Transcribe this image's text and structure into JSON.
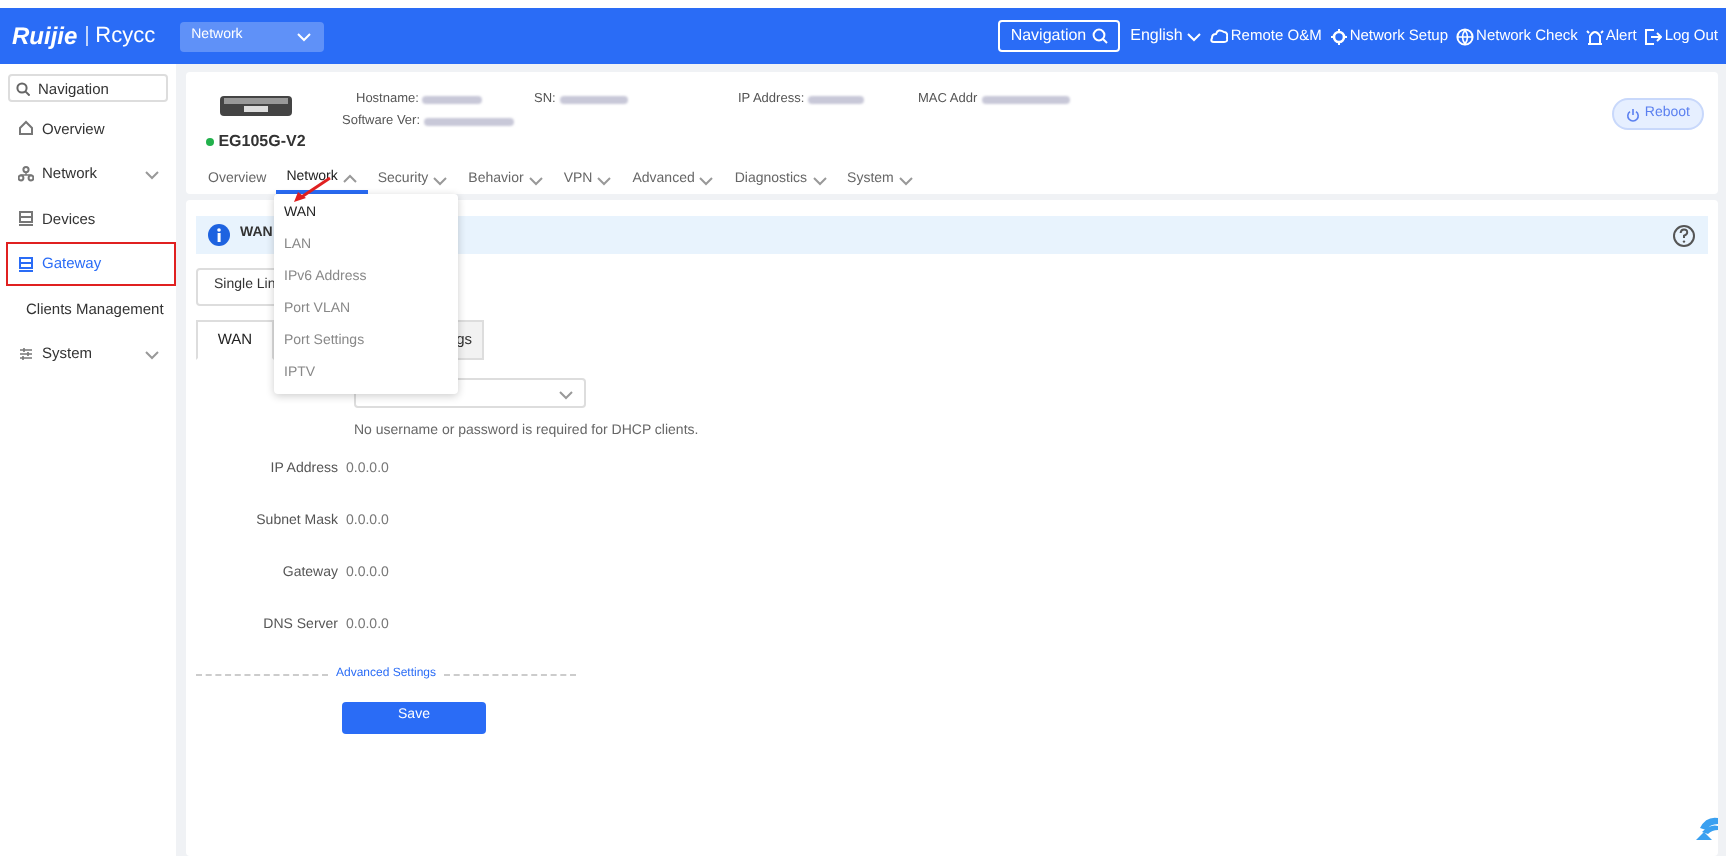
{
  "header": {
    "logo": "Ruijie",
    "brand": "Rcycc",
    "scope_select": "Network",
    "nav_search": "Navigation",
    "language": "English",
    "links": [
      {
        "kind": "cloud",
        "label": "Remote O&M"
      },
      {
        "kind": "setup",
        "label": "Network Setup"
      },
      {
        "kind": "check",
        "label": "Network Check"
      },
      {
        "kind": "alert",
        "label": "Alert"
      },
      {
        "kind": "logout",
        "label": "Log Out"
      }
    ]
  },
  "sidebar": {
    "search_placeholder": "Navigation",
    "items": [
      {
        "kind": "home",
        "label": "Overview",
        "selected": false,
        "expandable": false
      },
      {
        "kind": "network",
        "label": "Network",
        "selected": false,
        "expandable": true
      },
      {
        "kind": "devices",
        "label": "Devices",
        "selected": false,
        "expandable": false
      },
      {
        "kind": "gateway",
        "label": "Gateway",
        "selected": true,
        "expandable": false
      },
      {
        "kind": "clients",
        "label": "Clients Management",
        "selected": false,
        "expandable": false
      },
      {
        "kind": "system",
        "label": "System",
        "selected": false,
        "expandable": true
      }
    ]
  },
  "device": {
    "model": "EG105G-V2",
    "online": true,
    "fields": [
      {
        "label": "Hostname:"
      },
      {
        "label": "Software Ver:"
      },
      {
        "label": "SN:"
      },
      {
        "label": "IP Address:"
      },
      {
        "label": "MAC Addr"
      }
    ],
    "reboot": "Reboot"
  },
  "tabs": [
    {
      "label": "Overview",
      "selected": false
    },
    {
      "label": "Network",
      "selected": true
    },
    {
      "label": "Security",
      "selected": false
    },
    {
      "label": "Behavior",
      "selected": false
    },
    {
      "label": "VPN",
      "selected": false
    },
    {
      "label": "Advanced",
      "selected": false
    },
    {
      "label": "Diagnostics",
      "selected": false
    },
    {
      "label": "System",
      "selected": false
    }
  ],
  "dropdown": [
    {
      "label": "WAN",
      "selected": true
    },
    {
      "label": "LAN",
      "selected": false
    },
    {
      "label": "IPv6 Address",
      "selected": false
    },
    {
      "label": "Port VLAN",
      "selected": false
    },
    {
      "label": "Port Settings",
      "selected": false
    },
    {
      "label": "IPTV",
      "selected": false
    }
  ],
  "banner": "WAN",
  "line_select": "Single Lin",
  "wan_tabs": [
    {
      "label": "WAN",
      "selected": true
    },
    {
      "label": "gs",
      "selected": false
    }
  ],
  "hint": "No username or password is required for DHCP clients.",
  "fields": [
    {
      "label": "IP Address",
      "value": "0.0.0.0"
    },
    {
      "label": "Subnet Mask",
      "value": "0.0.0.0"
    },
    {
      "label": "Gateway",
      "value": "0.0.0.0"
    },
    {
      "label": "DNS Server",
      "value": "0.0.0.0"
    }
  ],
  "advanced": "Advanced Settings",
  "save": "Save"
}
